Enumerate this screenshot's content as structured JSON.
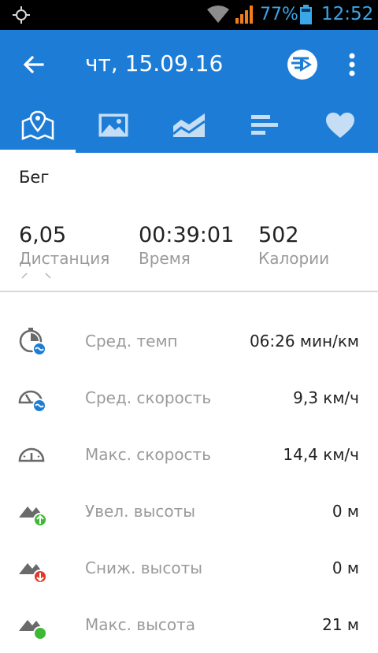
{
  "status_bar": {
    "battery_pct": "77%",
    "clock": "12:52"
  },
  "header": {
    "title": "чт, 15.09.16"
  },
  "tabs": [
    {
      "name": "map",
      "icon": "map-icon",
      "active": true
    },
    {
      "name": "photos",
      "icon": "image-icon",
      "active": false
    },
    {
      "name": "charts",
      "icon": "chart-icon",
      "active": false
    },
    {
      "name": "splits",
      "icon": "bars-icon",
      "active": false
    },
    {
      "name": "heart",
      "icon": "heart-icon",
      "active": false
    }
  ],
  "activity": {
    "type": "Бег",
    "stats": [
      {
        "value": "6,05",
        "label": "Дистанция"
      },
      {
        "value": "00:39:01",
        "label": "Время"
      },
      {
        "value": "502",
        "label": "Калории"
      }
    ]
  },
  "details": [
    {
      "icon": "avg-pace-icon",
      "label": "Сред. темп",
      "value": "06:26 мин/км"
    },
    {
      "icon": "avg-speed-icon",
      "label": "Сред. скорость",
      "value": "9,3 км/ч"
    },
    {
      "icon": "max-speed-icon",
      "label": "Макс. скорость",
      "value": "14,4 км/ч"
    },
    {
      "icon": "elevation-gain-icon",
      "label": "Увел. высоты",
      "value": "0 м"
    },
    {
      "icon": "elevation-loss-icon",
      "label": "Сниж. высоты",
      "value": "0 м"
    },
    {
      "icon": "max-elevation-icon",
      "label": "Макс. высота",
      "value": "21 м"
    }
  ],
  "colors": {
    "primary": "#1d7dd6",
    "status_text": "#3ba6e8",
    "label_gray": "#9a9a9a",
    "gain_green": "#3dba34",
    "loss_red": "#e0392b",
    "badge_blue": "#1d7dd6"
  }
}
